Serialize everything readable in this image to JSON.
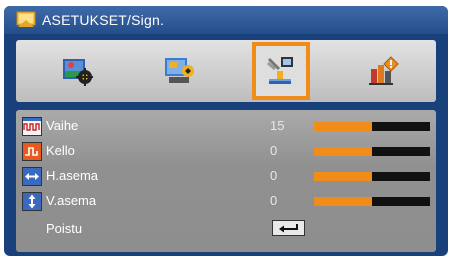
{
  "window": {
    "title": "ASETUKSET/Sign."
  },
  "tabs": [
    {
      "icon": "image-settings-icon"
    },
    {
      "icon": "display-settings-icon"
    },
    {
      "icon": "setup-signal-icon",
      "selected": true
    },
    {
      "icon": "options-icon"
    }
  ],
  "rows": [
    {
      "icon": "phase-icon",
      "label": "Vaihe",
      "value": "15",
      "level": 0.5
    },
    {
      "icon": "clock-icon",
      "label": "Kello",
      "value": "0",
      "level": 0.5
    },
    {
      "icon": "h-position-icon",
      "label": "H.asema",
      "value": "0",
      "level": 0.5
    },
    {
      "icon": "v-position-icon",
      "label": "V.asema",
      "value": "0",
      "level": 0.5
    }
  ],
  "exit": {
    "label": "Poistu",
    "icon": "enter-icon"
  },
  "colors": {
    "accent": "#f08c1a",
    "frame": "#18407a",
    "title_bar": "#2f5c9c"
  }
}
